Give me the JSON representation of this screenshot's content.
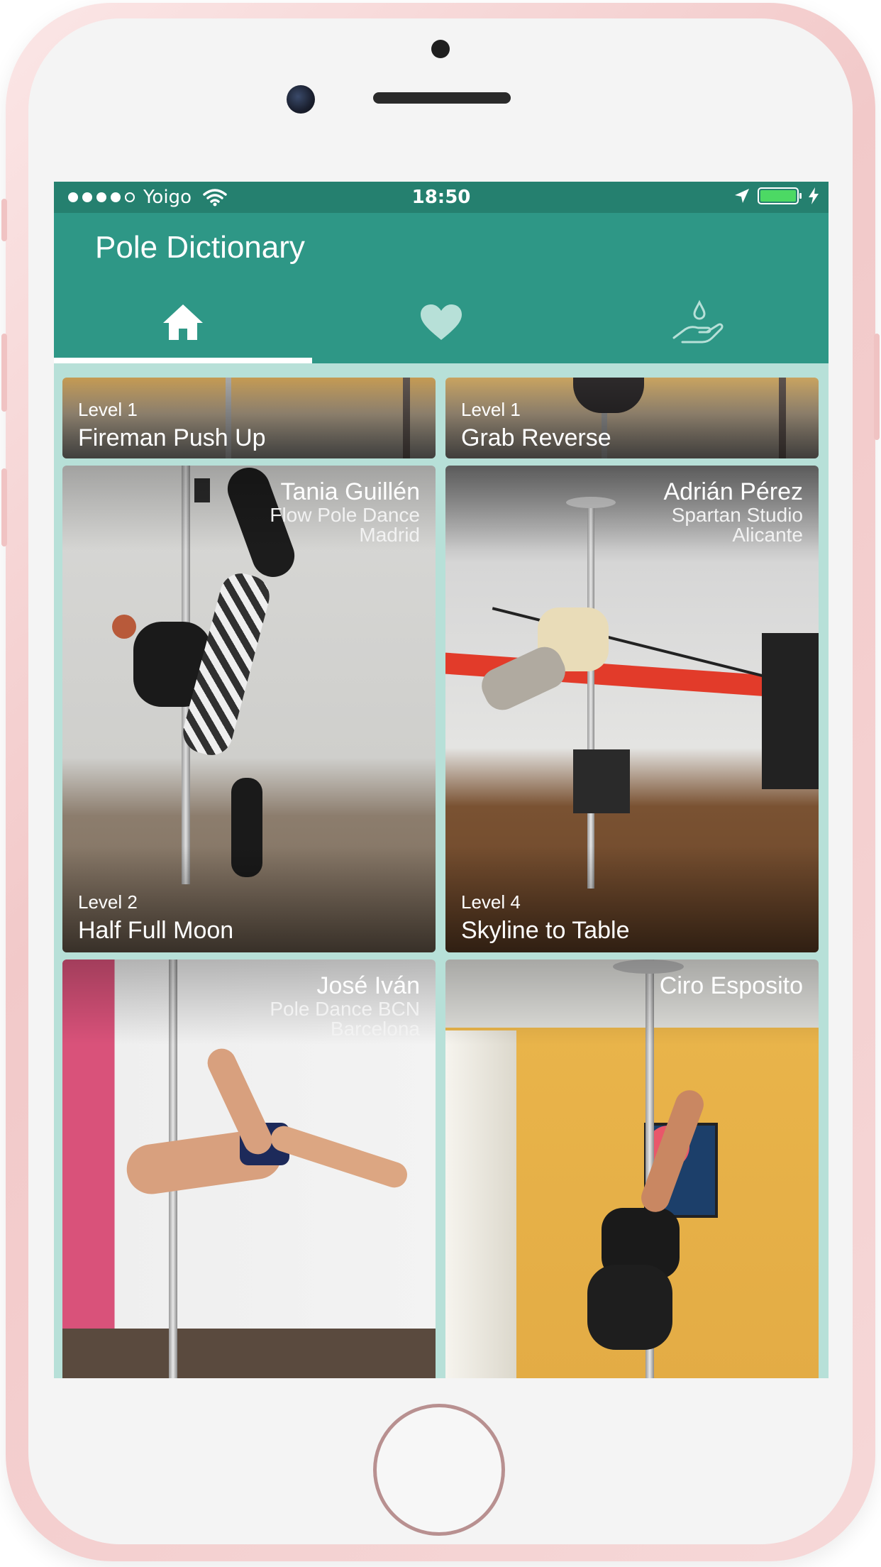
{
  "status_bar": {
    "carrier": "Yoigo",
    "time": "18:50"
  },
  "app": {
    "title": "Pole Dictionary"
  },
  "tabs": [
    {
      "icon": "home-icon",
      "selected": true
    },
    {
      "icon": "heart-icon",
      "selected": false
    },
    {
      "icon": "hand-water-drop-icon",
      "selected": false
    }
  ],
  "cards": [
    {
      "level": "Level 1",
      "title": "Fireman Push Up",
      "instructor": "",
      "studio": "",
      "city": ""
    },
    {
      "level": "Level 1",
      "title": "Grab Reverse",
      "instructor": "",
      "studio": "",
      "city": ""
    },
    {
      "level": "Level 2",
      "title": "Half Full Moon",
      "instructor": "Tania Guillén",
      "studio": "Flow Pole Dance",
      "city": "Madrid"
    },
    {
      "level": "Level 4",
      "title": "Skyline to Table",
      "instructor": "Adrián Pérez",
      "studio": "Spartan Studio",
      "city": "Alicante"
    },
    {
      "level": "",
      "title": "",
      "instructor": "José Iván",
      "studio": "Pole Dance BCN",
      "city": "Barcelona"
    },
    {
      "level": "",
      "title": "",
      "instructor": "Ciro Esposito",
      "studio": "",
      "city": ""
    }
  ],
  "colors": {
    "status_bar": "#25806f",
    "app_bar": "#2e9786",
    "grid_background": "#b7e0d8",
    "tab_indicator": "#ffffff",
    "battery": "#4cd964"
  }
}
